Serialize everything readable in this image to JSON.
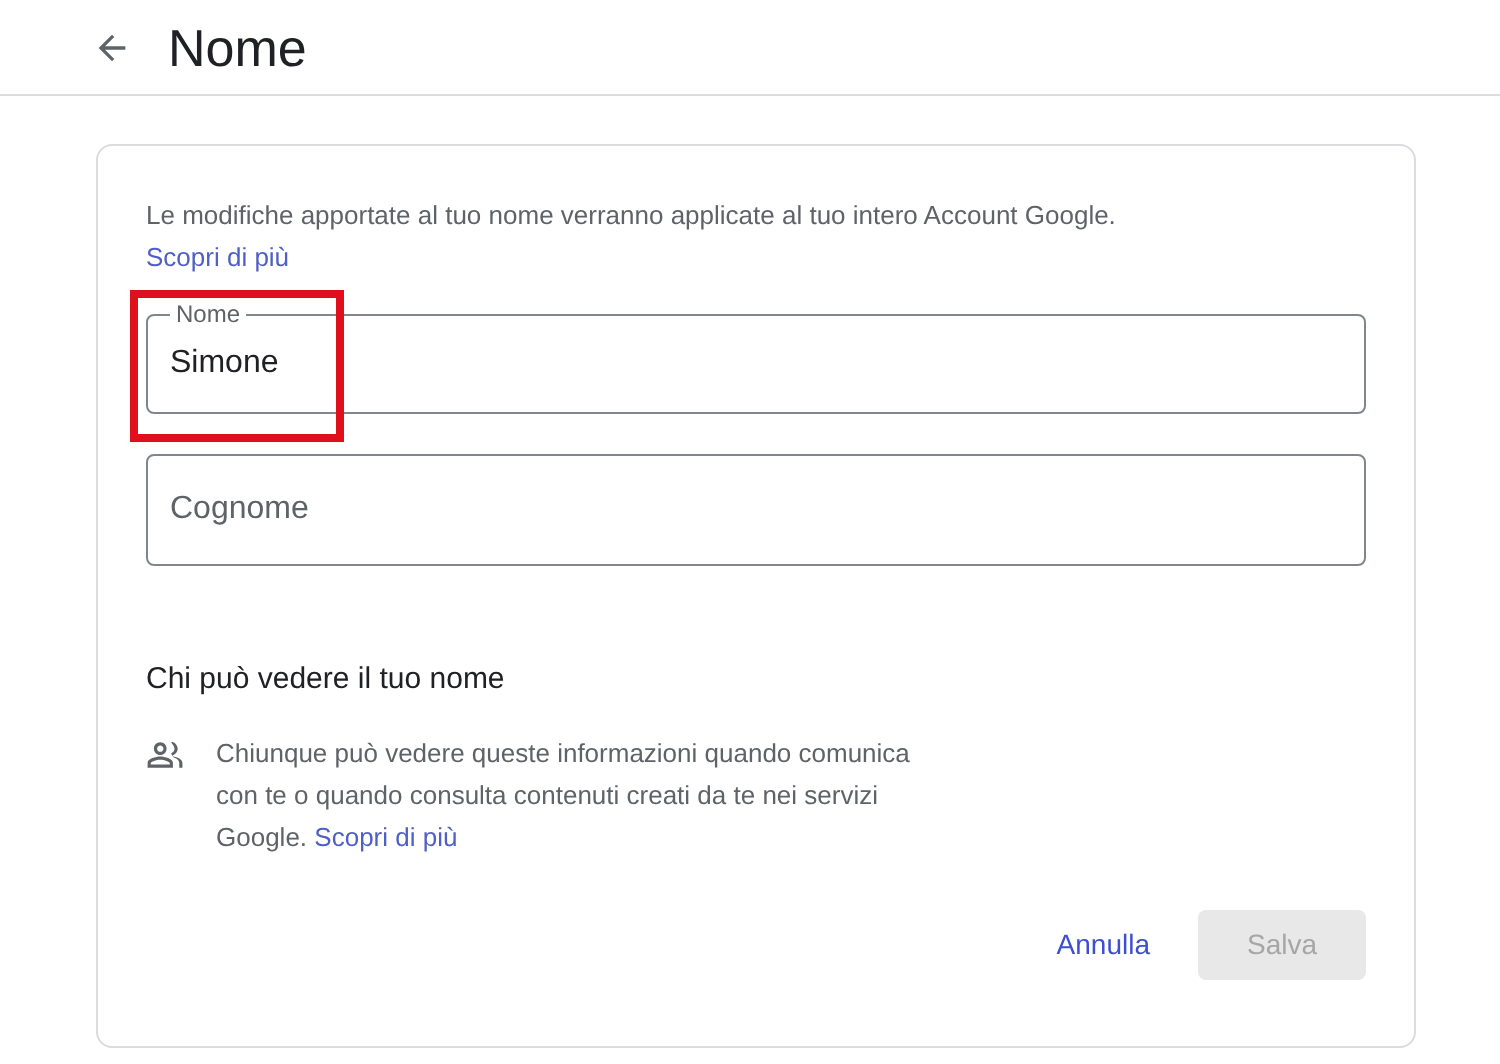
{
  "header": {
    "title": "Nome"
  },
  "card": {
    "intro": "Le modifiche apportate al tuo nome verranno applicate al tuo intero Account Google.",
    "intro_link": "Scopri di più",
    "fields": [
      {
        "label": "Nome",
        "value": "Simone",
        "highlighted": true
      },
      {
        "placeholder": "Cognome",
        "highlighted": false
      }
    ],
    "visibility": {
      "heading": "Chi può vedere il tuo nome",
      "text": "Chiunque può vedere queste informazioni quando comunica con te o quando consulta contenuti creati da te nei servizi Google.",
      "link": "Scopri di più"
    },
    "buttons": [
      {
        "label": "Annulla",
        "kind": "text",
        "disabled": false
      },
      {
        "label": "Salva",
        "kind": "filled",
        "disabled": true
      }
    ]
  }
}
